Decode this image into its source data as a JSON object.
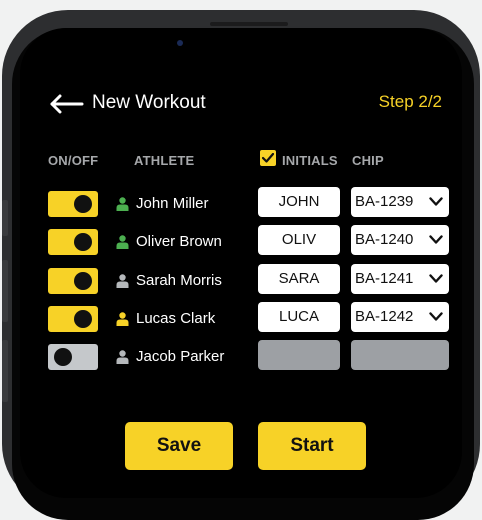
{
  "header": {
    "title": "New Workout",
    "step": "Step 2/2"
  },
  "columns": {
    "onoff": "ON/OFF",
    "athlete": "ATHLETE",
    "initials": "INITIALS",
    "chip": "CHIP"
  },
  "initials_all_checked": true,
  "athletes": [
    {
      "on": true,
      "name": "John Miller",
      "initials": "JOHN",
      "chip": "BA-1239",
      "icon_color": "#4caf50"
    },
    {
      "on": true,
      "name": "Oliver Brown",
      "initials": "OLIV",
      "chip": "BA-1240",
      "icon_color": "#4caf50"
    },
    {
      "on": true,
      "name": "Sarah Morris",
      "initials": "SARA",
      "chip": "BA-1241",
      "icon_color": "#b5b8bb"
    },
    {
      "on": true,
      "name": "Lucas Clark",
      "initials": "LUCA",
      "chip": "BA-1242",
      "icon_color": "#f7d227"
    },
    {
      "on": false,
      "name": "Jacob Parker",
      "initials": "",
      "chip": "",
      "icon_color": "#b5b8bb"
    }
  ],
  "buttons": {
    "save": "Save",
    "start": "Start"
  },
  "colors": {
    "accent": "#f7d227",
    "background": "#000000",
    "toggle_off": "#c5c8cb",
    "disabled_field": "#9da0a4"
  },
  "icons": [
    "back-arrow-icon",
    "checkbox-icon",
    "person-icon",
    "chevron-down-icon"
  ]
}
